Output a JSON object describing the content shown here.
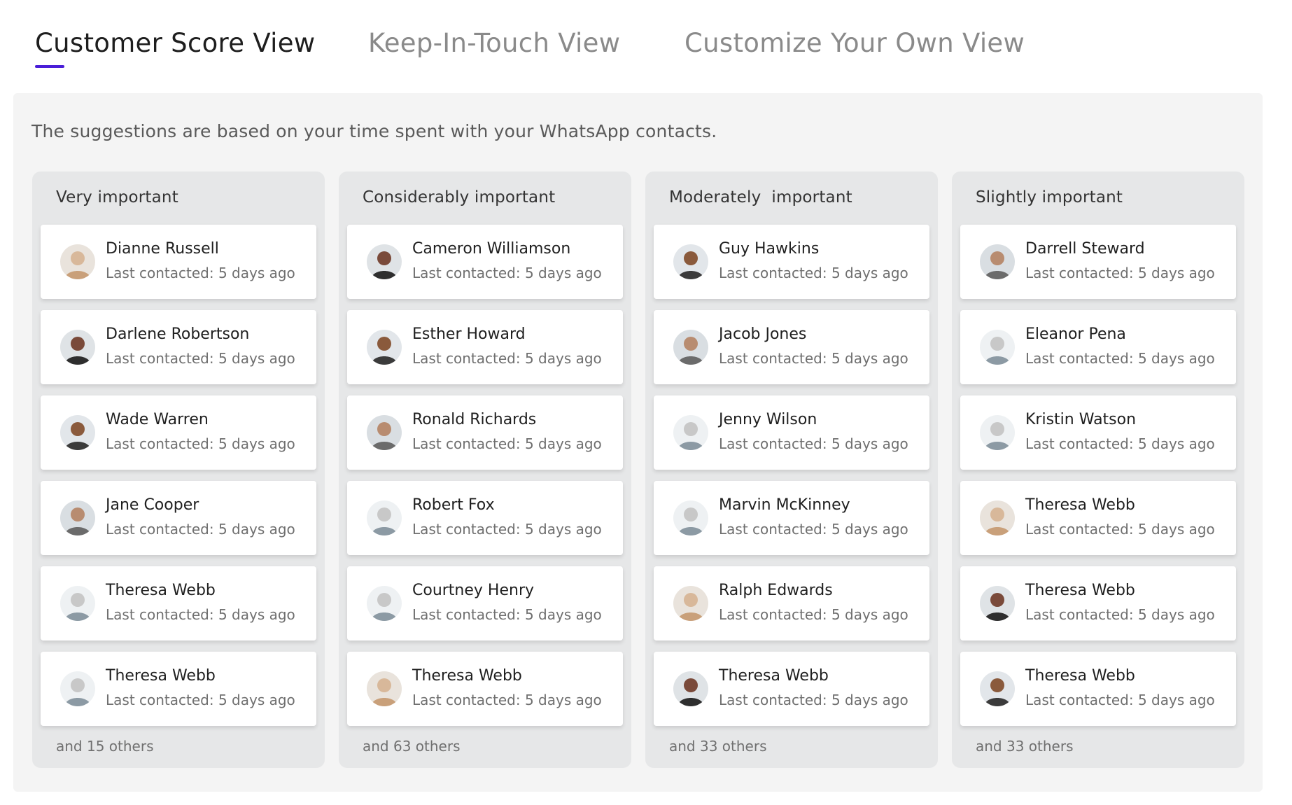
{
  "tabs": [
    {
      "label": "Customer Score View",
      "active": true
    },
    {
      "label": "Keep-In-Touch View",
      "active": false
    },
    {
      "label": "Customize Your Own View",
      "active": false
    }
  ],
  "panel": {
    "description": "The suggestions are based on your time spent with your WhatsApp contacts."
  },
  "columns": [
    {
      "title": "Very important",
      "contacts": [
        {
          "name": "Dianne Russell",
          "subtitle": "Last contacted: 5 days ago"
        },
        {
          "name": "Darlene Robertson",
          "subtitle": "Last contacted: 5 days ago"
        },
        {
          "name": "Wade Warren",
          "subtitle": "Last contacted: 5 days ago"
        },
        {
          "name": "Jane Cooper",
          "subtitle": "Last contacted: 5 days ago"
        },
        {
          "name": "Theresa Webb",
          "subtitle": "Last contacted: 5 days ago"
        },
        {
          "name": "Theresa Webb",
          "subtitle": "Last contacted: 5 days ago"
        }
      ],
      "others": "and 15 others"
    },
    {
      "title": "Considerably important",
      "contacts": [
        {
          "name": "Cameron Williamson",
          "subtitle": "Last contacted: 5 days ago"
        },
        {
          "name": "Esther Howard",
          "subtitle": "Last contacted: 5 days ago"
        },
        {
          "name": "Ronald Richards",
          "subtitle": "Last contacted: 5 days ago"
        },
        {
          "name": "Robert Fox",
          "subtitle": "Last contacted: 5 days ago"
        },
        {
          "name": "Courtney Henry",
          "subtitle": "Last contacted: 5 days ago"
        },
        {
          "name": "Theresa Webb",
          "subtitle": "Last contacted: 5 days ago"
        }
      ],
      "others": "and 63 others"
    },
    {
      "title": "Moderately  important",
      "contacts": [
        {
          "name": "Guy Hawkins",
          "subtitle": "Last contacted: 5 days ago"
        },
        {
          "name": "Jacob Jones",
          "subtitle": "Last contacted: 5 days ago"
        },
        {
          "name": "Jenny Wilson",
          "subtitle": "Last contacted: 5 days ago"
        },
        {
          "name": "Marvin McKinney",
          "subtitle": "Last contacted: 5 days ago"
        },
        {
          "name": "Ralph Edwards",
          "subtitle": "Last contacted: 5 days ago"
        },
        {
          "name": "Theresa Webb",
          "subtitle": "Last contacted: 5 days ago"
        }
      ],
      "others": "and 33 others"
    },
    {
      "title": "Slightly important",
      "contacts": [
        {
          "name": "Darrell Steward",
          "subtitle": "Last contacted: 5 days ago"
        },
        {
          "name": "Eleanor Pena",
          "subtitle": "Last contacted: 5 days ago"
        },
        {
          "name": "Kristin Watson",
          "subtitle": "Last contacted: 5 days ago"
        },
        {
          "name": "Theresa Webb",
          "subtitle": "Last contacted: 5 days ago"
        },
        {
          "name": "Theresa Webb",
          "subtitle": "Last contacted: 5 days ago"
        },
        {
          "name": "Theresa Webb",
          "subtitle": "Last contacted: 5 days ago"
        }
      ],
      "others": "and 33 others"
    }
  ]
}
